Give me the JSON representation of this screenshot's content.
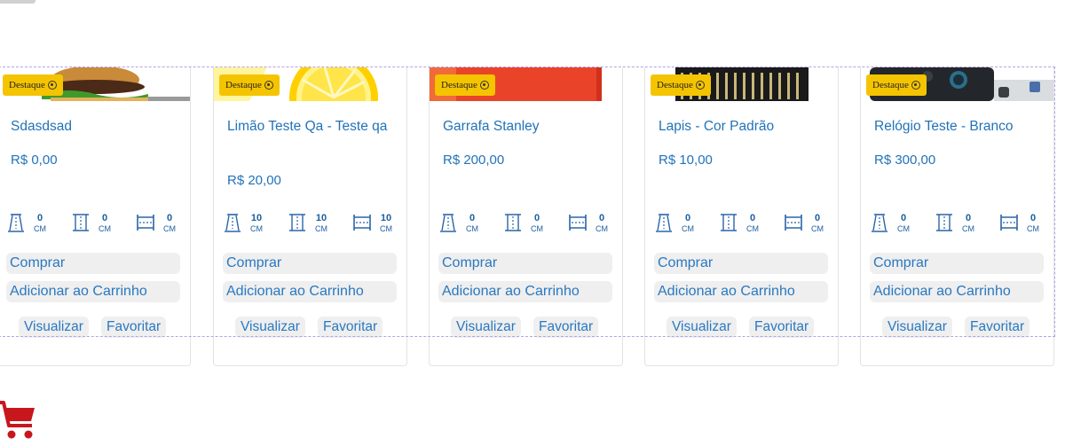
{
  "badge_label": "Destaque",
  "unit": "CM",
  "actions": {
    "buy": "Comprar",
    "add_to_cart": "Adicionar ao Carrinho",
    "view": "Visualizar",
    "favorite": "Favoritar"
  },
  "products": [
    {
      "name": "Sdasdsad",
      "price": "R$ 0,00",
      "height": "0",
      "width": "0",
      "length": "0",
      "image": "burger"
    },
    {
      "name": "Limão Teste Qa - Teste qa",
      "price": "R$ 20,00",
      "height": "10",
      "width": "10",
      "length": "10",
      "image": "lemon"
    },
    {
      "name": "Garrafa Stanley",
      "price": "R$ 200,00",
      "height": "0",
      "width": "0",
      "length": "0",
      "image": "bottle"
    },
    {
      "name": "Lapis - Cor Padrão",
      "price": "R$ 10,00",
      "height": "0",
      "width": "0",
      "length": "0",
      "image": "pencils"
    },
    {
      "name": "Relógio Teste - Branco",
      "price": "R$ 300,00",
      "height": "0",
      "width": "0",
      "length": "0",
      "image": "watch"
    }
  ],
  "colors": {
    "accent_blue": "#2173b9",
    "badge_yellow": "#f5c400",
    "cart_red": "#c8161d"
  },
  "cart_icon": "shopping-cart-icon"
}
